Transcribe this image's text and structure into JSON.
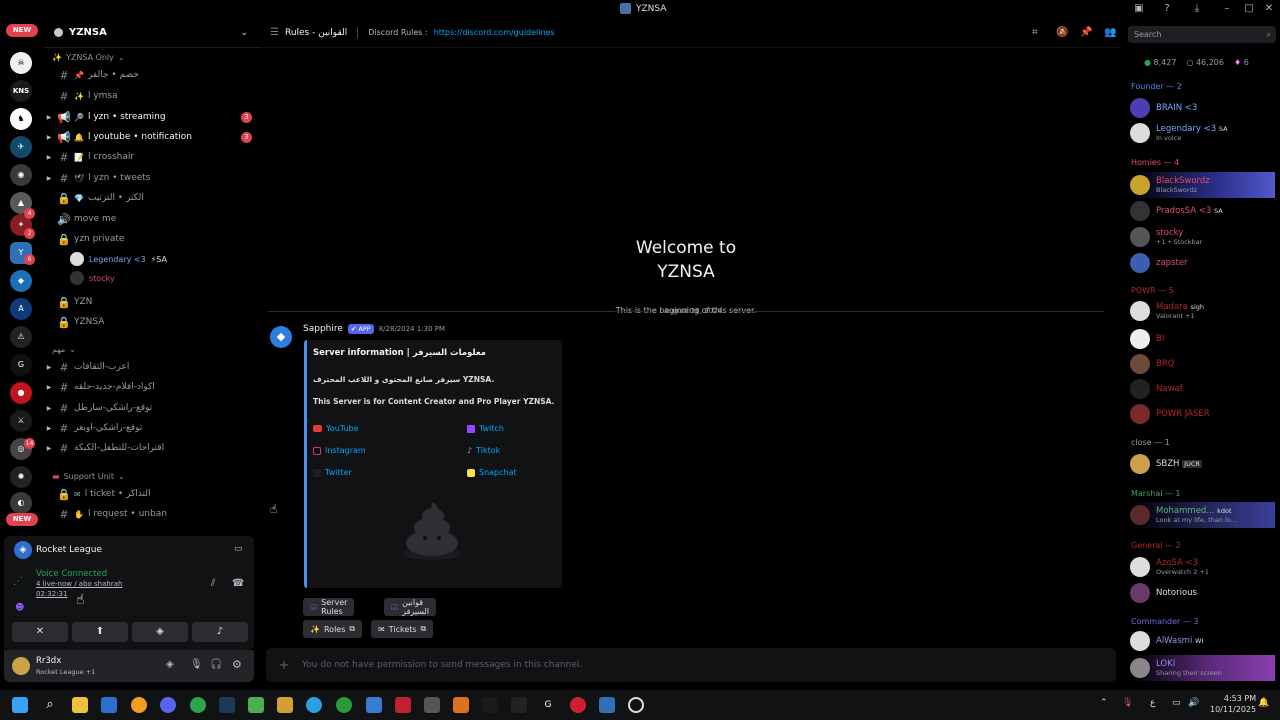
{
  "window": {
    "title": "YZNSA",
    "search_placeholder": "Search"
  },
  "rail": {
    "new_label": "NEW",
    "new_label_bottom": "NEW",
    "kns_label": "KNS",
    "badges": [
      "4",
      "2",
      "6",
      "14"
    ]
  },
  "guild": {
    "name": "YZNSA"
  },
  "channels": {
    "category_top": "YZNSA Only",
    "items": [
      {
        "name": "خصم • جالفر",
        "emoji": "📌",
        "unread": false
      },
      {
        "name": "l ymsa",
        "emoji": "✨",
        "unread": false
      },
      {
        "name": "l yzn • streaming",
        "emoji": "🔎",
        "unread": true,
        "mentions": "3"
      },
      {
        "name": "l youtube • notification",
        "emoji": "🔔",
        "unread": true,
        "mentions": "3"
      },
      {
        "name": "l crosshair",
        "emoji": "📝",
        "unread": false
      },
      {
        "name": "l yzn • tweets",
        "emoji": "🕊",
        "unread": false
      },
      {
        "name": "الكثر • الترتيب",
        "emoji": "💎",
        "unread": false
      },
      {
        "name": "move me",
        "emoji": "",
        "unread": false
      },
      {
        "name": "yzn private",
        "emoji": "",
        "unread": false
      }
    ],
    "voice_users": [
      {
        "name": "Legendary <3",
        "tag": "SA"
      },
      {
        "name": "stocky"
      }
    ],
    "items2": [
      "YZN",
      "YZNSA"
    ],
    "category_mid": "مهم",
    "items3": [
      "اعرب-الثقافات",
      "اكواد-افلام-جديد-حلقه",
      "توقع-راشكي-سارطل",
      "توقع-راشكي-اوبغر",
      "اقتراحات-للتطفل-الكبكة"
    ],
    "category_support": "Support Unit",
    "support_items": [
      "l ticket • التذاكر",
      "l request • unban"
    ]
  },
  "activity": {
    "game": "Rocket League"
  },
  "voice": {
    "status": "Voice Connected",
    "channel": "4 live-now / abo shahrah",
    "time": "02:32:31"
  },
  "user": {
    "name": "Rr3dx",
    "status": "Rocket League +1"
  },
  "header": {
    "channel": "Rules - القوانين",
    "rules_label": "Discord Rules :",
    "rules_link": "https://discord.com/guidelines"
  },
  "welcome": {
    "title_line1": "Welcome to",
    "title_line2": "YZNSA",
    "subtitle": "This is the beginning of this server.",
    "date": "August 28, 2024"
  },
  "message": {
    "author": "Sapphire",
    "app_tag": "APP",
    "time": "8/28/2024 1:30 PM",
    "embed_title": "Server information | معلومات السيرفر",
    "embed_line1": "سيرفر صانع المحتوى و اللاعب المحترف YZNSA.",
    "embed_line2": "This Server is for Content Creator and Pro Player YZNSA.",
    "links": [
      {
        "label": "YouTube",
        "color": "#e53935"
      },
      {
        "label": "Twitch",
        "color": "#9146ff"
      },
      {
        "label": "Instagram",
        "color": "#e1306c"
      },
      {
        "label": "Tiktok",
        "color": "#9aa0a6"
      },
      {
        "label": "Twitter",
        "color": "#1d1e21"
      },
      {
        "label": "Snapchat",
        "color": "#f7e04b"
      }
    ],
    "buttons": [
      {
        "label": "Server Rules"
      },
      {
        "label": "قوانين السيرفر"
      },
      {
        "label": "Roles"
      },
      {
        "label": "Tickets"
      }
    ]
  },
  "composer": {
    "placeholder": "You do not have permission to send messages in this channel."
  },
  "stats": {
    "online": "8,427",
    "members": "46,206",
    "boosts": "6"
  },
  "members": {
    "groups": [
      {
        "label": "Founder — 2",
        "color": "#4c8ee8"
      },
      {
        "label": "Homies — 4",
        "color": "#e24c6a"
      },
      {
        "label": "POWR — 5",
        "color": "#b3262d"
      },
      {
        "label": "close — 1",
        "color": "#949ba4"
      },
      {
        "label": "Marshal — 1",
        "color": "#4f9a6a"
      },
      {
        "label": "General — 2",
        "color": "#b3262d"
      },
      {
        "label": "Commander — 3",
        "color": "#6a6ee0"
      }
    ],
    "list": [
      {
        "name": "BRAIN <3",
        "sub": "",
        "color": "#7aa7ff"
      },
      {
        "name": "Legendary <3",
        "sub": "In voice",
        "color": "#7aa7ff",
        "tag": "SA"
      },
      {
        "name": "BlackSwordz",
        "sub": "BlackSwordz",
        "color": "#e24c6a"
      },
      {
        "name": "PradosSA <3",
        "sub": "",
        "color": "#e24c6a",
        "tag": "SA"
      },
      {
        "name": "stocky",
        "sub": "+1 • Stockbar",
        "color": "#e24c6a"
      },
      {
        "name": "zapster",
        "sub": "",
        "color": "#e24c6a"
      },
      {
        "name": "Madara",
        "sub": "Valorant +1",
        "color": "#b3262d",
        "tag": "sigh"
      },
      {
        "name": "BI",
        "sub": "",
        "color": "#b3262d"
      },
      {
        "name": "BRQ",
        "sub": "",
        "color": "#b3262d"
      },
      {
        "name": "Nawaf",
        "sub": "",
        "color": "#b3262d"
      },
      {
        "name": "POWR JASER",
        "sub": "",
        "color": "#b3262d"
      },
      {
        "name": "SBZH",
        "sub": "",
        "color": "#dbdee1",
        "tag": "JUCR"
      },
      {
        "name": "Mohammed...",
        "sub": "Look at my life, than lo...",
        "color": "#5ab87c",
        "tag": "kdot"
      },
      {
        "name": "AzoSA <3",
        "sub": "Overwatch 2 +1",
        "color": "#b3262d"
      },
      {
        "name": "Notorious",
        "sub": "",
        "color": "#dbdee1"
      },
      {
        "name": "AlWasmi",
        "sub": "",
        "color": "#8f93f0",
        "tag": "WI"
      },
      {
        "name": "LOKI",
        "sub": "Sharing their screen",
        "color": "#8f93f0"
      }
    ]
  },
  "taskbar": {
    "time": "4:53 PM",
    "date": "10/11/2025",
    "lang": "ع"
  }
}
